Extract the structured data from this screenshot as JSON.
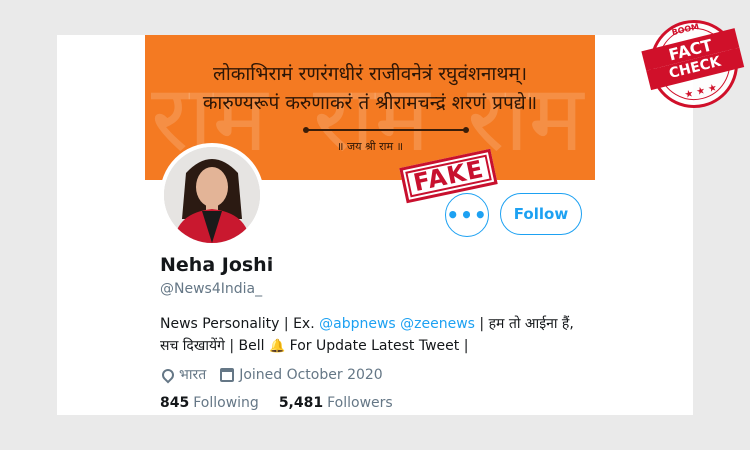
{
  "banner": {
    "line1": "लोकाभिरामं रणरंगधीरं राजीवनेत्रं रघुवंशनाथम्।",
    "line2": "कारुण्यरूपं करुणाकरं तं श्रीरामचन्द्रं शरणं प्रपद्ये॥",
    "caption": "॥ जय श्री राम ॥",
    "watermark_text": "राम",
    "color": "#f47a22"
  },
  "profile": {
    "name": "Neha Joshi",
    "handle": "@News4India_",
    "bio": {
      "part1": "News Personality | Ex. ",
      "mention1": "@abpnews",
      "mention2": "@zeenews",
      "part2": " | हम तो आईना हैं, सच दिखायेंगे | Bell ",
      "part3": " For Update Latest Tweet |"
    },
    "location": "भारत",
    "joined": "Joined October 2020",
    "following_count": "845",
    "following_label": "Following",
    "followers_count": "5,481",
    "followers_label": "Followers"
  },
  "actions": {
    "more_label": "•••",
    "follow_label": "Follow"
  },
  "overlays": {
    "fake_stamp": "FAKE",
    "fact_check_brand": "BOOM",
    "fact_check_word1": "FACT",
    "fact_check_word2": "CHECK",
    "fact_check_stars": "★ ★ ★"
  },
  "icons": {
    "location": "location-pin-icon",
    "calendar": "calendar-icon",
    "bell": "bell-icon"
  },
  "colors": {
    "accent": "#1da1f2",
    "stamp_red": "#c8102e"
  }
}
